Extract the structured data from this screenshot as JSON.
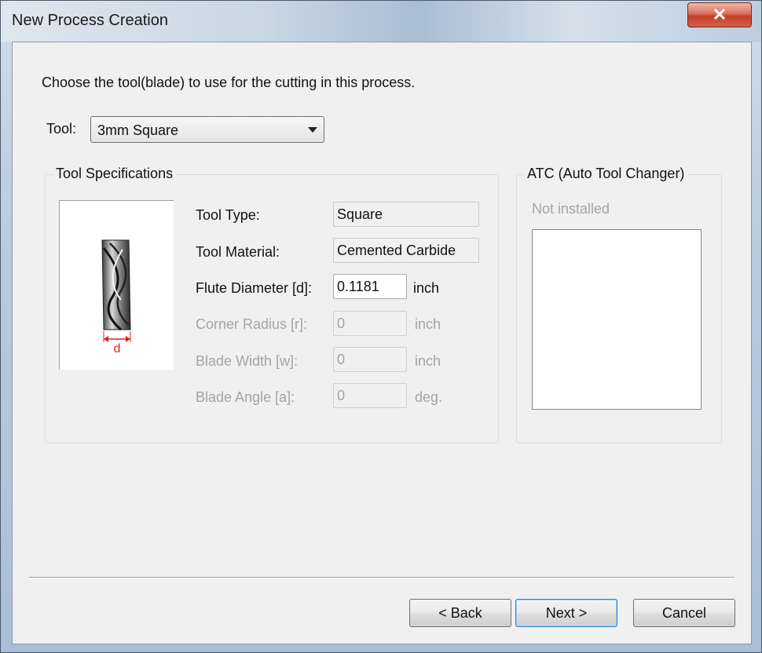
{
  "window": {
    "title": "New Process Creation",
    "close_glyph": "✕"
  },
  "instruction": "Choose the tool(blade) to use for the cutting in this process.",
  "tool": {
    "label": "Tool:",
    "selected": "3mm Square"
  },
  "specs": {
    "title": "Tool Specifications",
    "image_label": "d",
    "rows": [
      {
        "label": "Tool Type:",
        "value": "Square",
        "unit": "",
        "enabled": true
      },
      {
        "label": "Tool Material:",
        "value": "Cemented Carbide",
        "unit": "",
        "enabled": true
      },
      {
        "label": "Flute Diameter [d]:",
        "value": "0.1181",
        "unit": "inch",
        "enabled": true
      },
      {
        "label": "Corner Radius [r]:",
        "value": "0",
        "unit": "inch",
        "enabled": false
      },
      {
        "label": "Blade Width [w]:",
        "value": "0",
        "unit": "inch",
        "enabled": false
      },
      {
        "label": "Blade Angle [a]:",
        "value": "0",
        "unit": "deg.",
        "enabled": false
      }
    ]
  },
  "atc": {
    "title": "ATC (Auto Tool Changer)",
    "status": "Not installed"
  },
  "buttons": {
    "back": "< Back",
    "next": "Next >",
    "cancel": "Cancel"
  },
  "colors": {
    "dimension_marker": "#e02020",
    "title_bar": "#c9d6e4",
    "close_button": "#c2402b"
  }
}
